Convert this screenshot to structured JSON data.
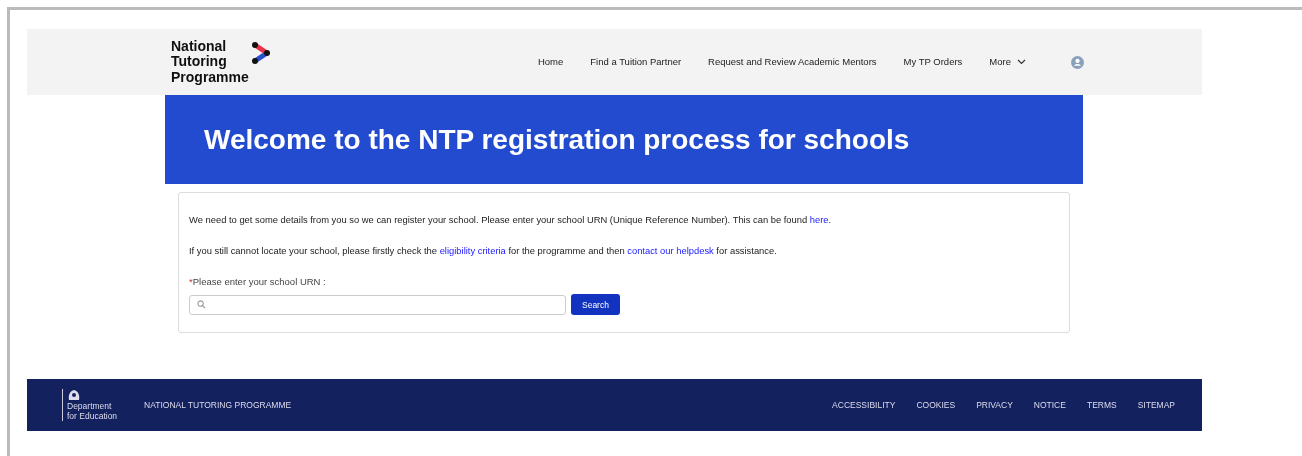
{
  "header": {
    "logo": [
      "National",
      "Tutoring",
      "Programme"
    ],
    "nav": [
      {
        "label": "Home",
        "kind": "link"
      },
      {
        "label": "Find a Tuition Partner",
        "kind": "link"
      },
      {
        "label": "Request and Review Academic Mentors",
        "kind": "link"
      },
      {
        "label": "My TP Orders",
        "kind": "link"
      },
      {
        "label": "More",
        "kind": "dropdown"
      }
    ]
  },
  "hero": {
    "title": "Welcome to the NTP registration process for schools"
  },
  "form": {
    "paragraphs": [
      [
        {
          "kind": "text",
          "text": "We need to get some details from you so we can register your school. Please enter your school URN (Unique Reference Number). This can be found "
        },
        {
          "kind": "link",
          "text": "here"
        },
        {
          "kind": "text",
          "text": "."
        }
      ],
      [
        {
          "kind": "text",
          "text": "If you still cannot locate your school, please firstly check the "
        },
        {
          "kind": "link",
          "text": "eligibility criteria"
        },
        {
          "kind": "text",
          "text": " for the programme and then "
        },
        {
          "kind": "link",
          "text": "contact our helpdesk"
        },
        {
          "kind": "text",
          "text": " for assistance."
        }
      ]
    ],
    "required_mark": "*",
    "label": "Please enter your school URN :",
    "button": "Search"
  },
  "footer": {
    "logo": [
      "Department",
      "for Education"
    ],
    "title": "NATIONAL TUTORING PROGRAMME",
    "links": [
      "ACCESSIBILITY",
      "COOKIES",
      "PRIVACY",
      "NOTICE",
      "TERMS",
      "SITEMAP"
    ]
  }
}
